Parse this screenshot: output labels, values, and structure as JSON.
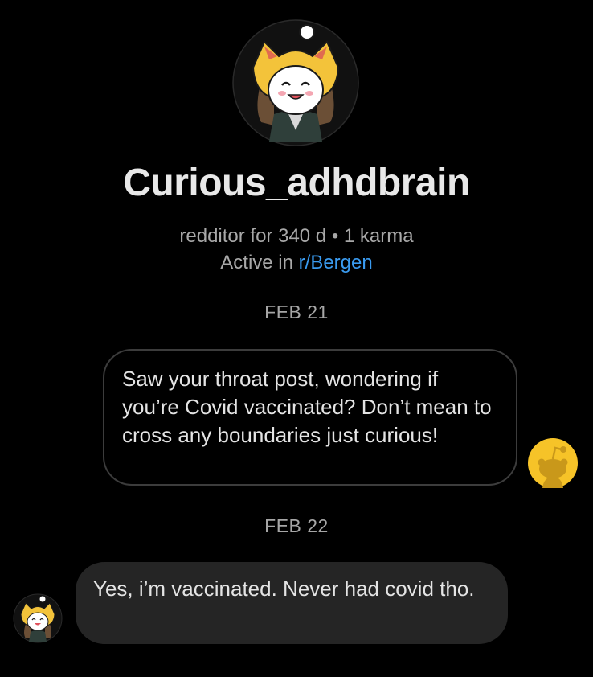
{
  "profile": {
    "username": "Curious_adhdbrain",
    "age_text": "redditor for 340 d",
    "separator": "•",
    "karma_text": "1 karma",
    "active_prefix": "Active in ",
    "active_community": "r/Bergen"
  },
  "messages": [
    {
      "date": "FEB 21",
      "direction": "outgoing",
      "text": "Saw your throat post, wondering if you’re Covid vaccinated? Don’t mean to cross any boundaries just curious!"
    },
    {
      "date": "FEB 22",
      "direction": "incoming",
      "text": "Yes, i’m vaccinated. Never had covid tho."
    }
  ],
  "colors": {
    "background": "#000000",
    "link": "#3a9bf0",
    "incoming_bubble": "#252525",
    "default_avatar": "#f6c328"
  },
  "icons": {
    "profile_avatar": "snoo-shiba-avatar",
    "self_avatar": "default-snoo-avatar",
    "other_avatar": "snoo-shiba-avatar"
  }
}
